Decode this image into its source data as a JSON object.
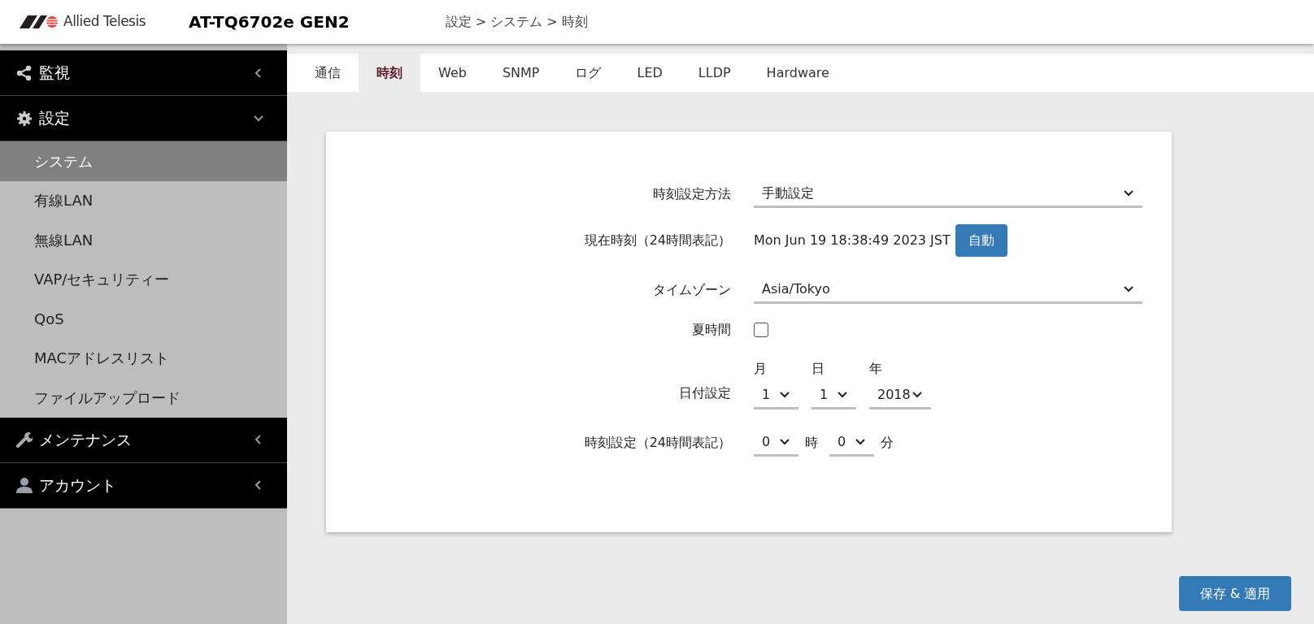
{
  "header": {
    "logo_text": "Allied Telesis",
    "model": "AT-TQ6702e GEN2",
    "breadcrumb": "設定 > システム > 時刻"
  },
  "sidebar": {
    "sections": [
      {
        "label": "監視",
        "expanded": false
      },
      {
        "label": "設定",
        "expanded": true,
        "children": [
          {
            "label": "システム",
            "selected": true
          },
          {
            "label": "有線LAN",
            "selected": false
          },
          {
            "label": "無線LAN",
            "selected": false
          },
          {
            "label": "VAP/セキュリティー",
            "selected": false
          },
          {
            "label": "QoS",
            "selected": false
          },
          {
            "label": "MACアドレスリスト",
            "selected": false
          },
          {
            "label": "ファイルアップロード",
            "selected": false
          }
        ]
      },
      {
        "label": "メンテナンス",
        "expanded": false
      },
      {
        "label": "アカウント",
        "expanded": false
      }
    ]
  },
  "tabs": [
    {
      "label": "通信",
      "selected": false
    },
    {
      "label": "時刻",
      "selected": true
    },
    {
      "label": "Web",
      "selected": false
    },
    {
      "label": "SNMP",
      "selected": false
    },
    {
      "label": "ログ",
      "selected": false
    },
    {
      "label": "LED",
      "selected": false
    },
    {
      "label": "LLDP",
      "selected": false
    },
    {
      "label": "Hardware",
      "selected": false
    }
  ],
  "form": [
    {
      "kind": "select",
      "label": "時刻設定方法",
      "value": "手動設定"
    },
    {
      "kind": "text_button",
      "label": "現在時刻（24時間表記）",
      "value": "Mon Jun 19 18:38:49 2023 JST",
      "button": "自動"
    },
    {
      "kind": "select",
      "label": "タイムゾーン",
      "value": "Asia/Tokyo"
    },
    {
      "kind": "checkbox",
      "label": "夏時間",
      "checked": false
    },
    {
      "kind": "date",
      "label": "日付設定",
      "parts": [
        {
          "caption": "月",
          "value": "1"
        },
        {
          "caption": "日",
          "value": "1"
        },
        {
          "caption": "年",
          "value": "2018"
        }
      ]
    },
    {
      "kind": "time",
      "label": "時刻設定（24時間表記）",
      "parts": [
        {
          "value": "0",
          "unit": "時"
        },
        {
          "value": "0",
          "unit": "分"
        }
      ]
    }
  ],
  "save_button": "保存 & 適用"
}
